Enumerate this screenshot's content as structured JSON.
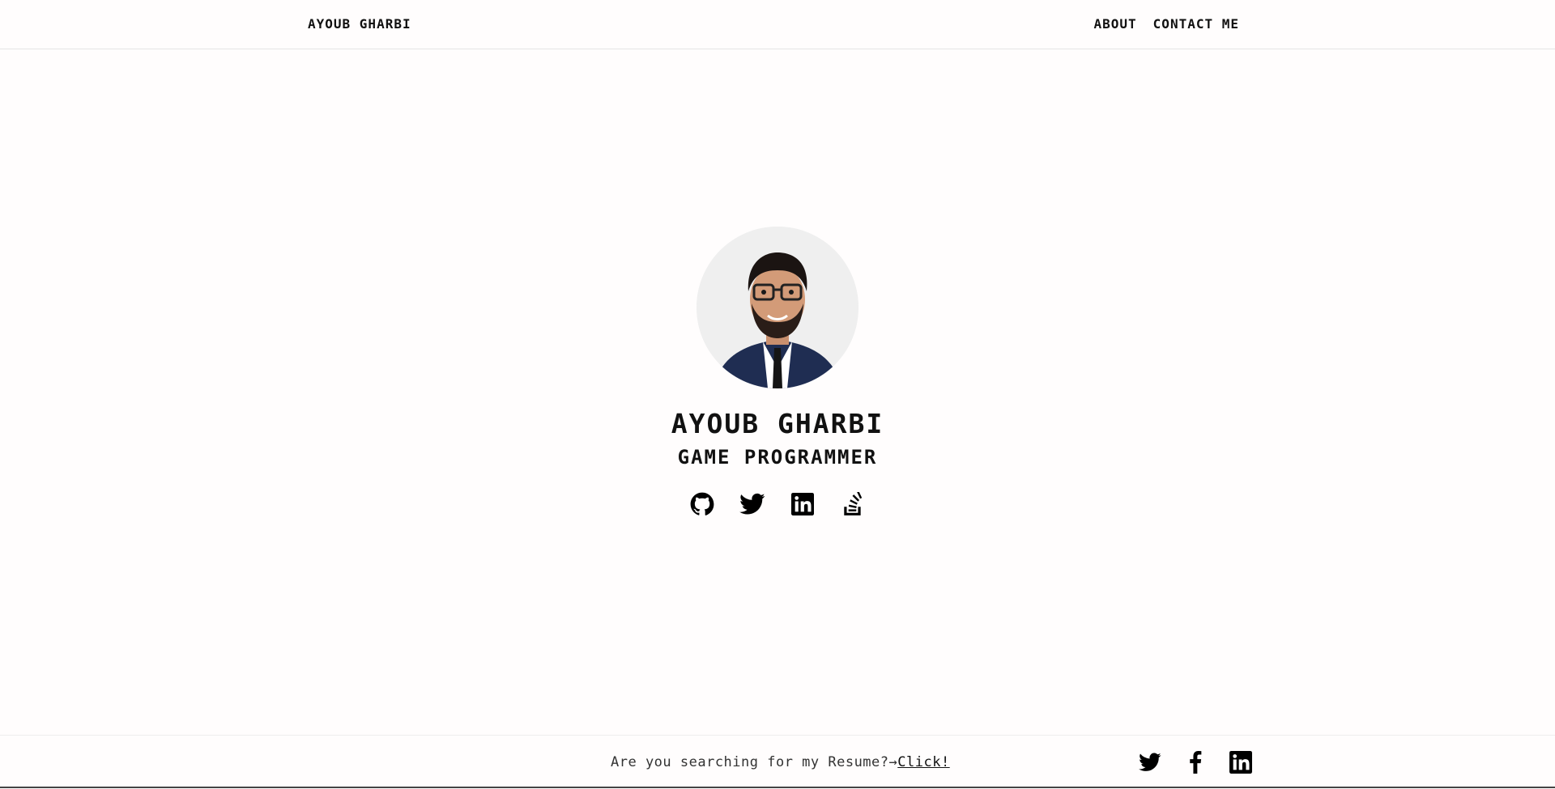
{
  "nav": {
    "brand": "AYOUB GHARBI",
    "links": [
      "ABOUT",
      "CONTACT ME"
    ]
  },
  "hero": {
    "name": "AYOUB GHARBI",
    "role": "GAME PROGRAMMER",
    "social_icons": [
      "github-icon",
      "twitter-icon",
      "linkedin-icon",
      "stackoverflow-icon"
    ]
  },
  "footer": {
    "text": "Are you searching for my Resume?→",
    "link": "Click!",
    "social_icons": [
      "twitter-icon",
      "facebook-icon",
      "linkedin-icon"
    ]
  },
  "colors": {
    "background": "#fffdfd",
    "text": "#111111",
    "border": "#e4e4e4"
  }
}
